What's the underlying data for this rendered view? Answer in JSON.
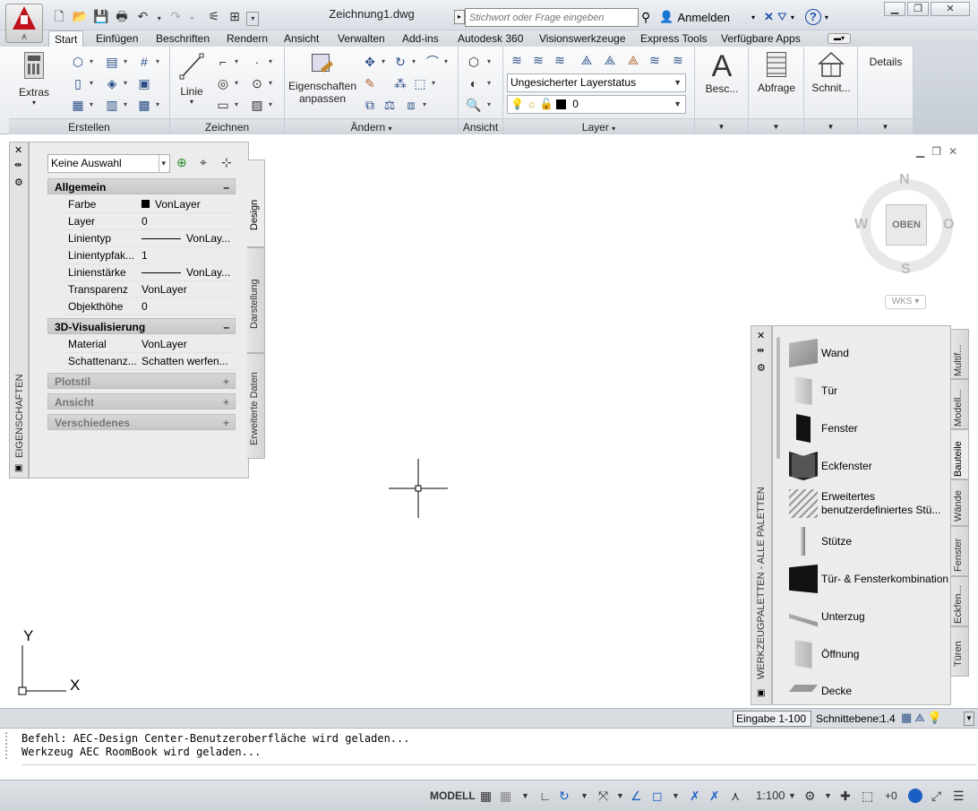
{
  "app": {
    "logo_letter": "A",
    "document_title": "Zeichnung1.dwg",
    "search_placeholder": "Stichwort oder Frage eingeben",
    "signin": "Anmelden",
    "help_label": "?"
  },
  "tabs": [
    "Start",
    "Einfügen",
    "Beschriften",
    "Rendern",
    "Ansicht",
    "Verwalten",
    "Add-ins",
    "Autodesk 360",
    "Visionswerkzeuge",
    "Express Tools",
    "Verfügbare Apps"
  ],
  "ribbon": {
    "extras_label": "Extras",
    "linie_label": "Linie",
    "eigenschaften_label_1": "Eigenschaften",
    "eigenschaften_label_2": "anpassen",
    "layer_state": "Ungesicherter Layerstatus",
    "layer_current": "0",
    "besc_label": "Besc...",
    "abfrage_label": "Abfrage",
    "schnit_label": "Schnit...",
    "details_label": "Details",
    "panels": {
      "erstellen": "Erstellen",
      "zeichnen": "Zeichnen",
      "aendern": "Ändern",
      "ansicht": "Ansicht",
      "layer": "Layer"
    }
  },
  "properties": {
    "title": "EIGENSCHAFTEN",
    "selection": "Keine Auswahl",
    "tabs": [
      "Design",
      "Darstellung",
      "Erweiterte Daten"
    ],
    "sections": {
      "allgemein": "Allgemein",
      "visualisierung": "3D-Visualisierung",
      "plotstil": "Plotstil",
      "ansicht": "Ansicht",
      "verschiedenes": "Verschiedenes"
    },
    "general_rows": [
      {
        "key": "Farbe",
        "value": "VonLayer"
      },
      {
        "key": "Layer",
        "value": "0"
      },
      {
        "key": "Linientyp",
        "value": "VonLay..."
      },
      {
        "key": "Linientypfak...",
        "value": "1"
      },
      {
        "key": "Linienstärke",
        "value": "VonLay..."
      },
      {
        "key": "Transparenz",
        "value": "VonLayer"
      },
      {
        "key": "Objekthöhe",
        "value": "0"
      }
    ],
    "viz_rows": [
      {
        "key": "Material",
        "value": "VonLayer"
      },
      {
        "key": "Schattenanz...",
        "value": "Schatten  werfen..."
      }
    ]
  },
  "viewcube": {
    "n": "N",
    "s": "S",
    "w": "W",
    "o": "O",
    "face": "OBEN",
    "wcs": "WKS"
  },
  "toolpalette": {
    "title": "WERKZEUGPALETTEN - ALLE PALETTEN",
    "tabs": [
      "Multif...",
      "Modell...",
      "Bauteile",
      "Wände",
      "Fenster",
      "Eckfen...",
      "Türen"
    ],
    "tools": [
      {
        "label": "Wand"
      },
      {
        "label": "Tür"
      },
      {
        "label": "Fenster"
      },
      {
        "label": "Eckfenster"
      },
      {
        "label": "Erweitertes benutzerdefiniertes  Stü..."
      },
      {
        "label": "Stütze"
      },
      {
        "label": "Tür- & Fensterkombination"
      },
      {
        "label": "Unterzug"
      },
      {
        "label": "Öffnung"
      },
      {
        "label": "Decke"
      }
    ]
  },
  "ucs": {
    "x": "X",
    "y": "Y"
  },
  "statusline": {
    "eingabe": "Eingabe 1-100",
    "schnittebene_label": "Schnittebene:",
    "schnittebene_value": "1.4"
  },
  "command_history": [
    "Befehl: AEC-Design Center-Benutzeroberfläche wird geladen...",
    "Werkzeug AEC RoomBook wird geladen..."
  ],
  "statusbar": {
    "model": "MODELL",
    "scale": "1:100",
    "offset": "+0"
  }
}
